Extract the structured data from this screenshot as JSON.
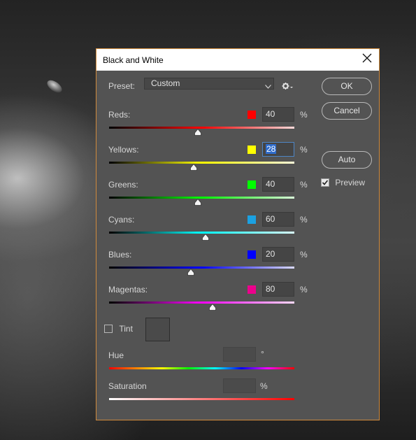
{
  "dialog": {
    "title": "Black and White",
    "close_icon": "close-icon"
  },
  "preset": {
    "label": "Preset:",
    "value": "Custom",
    "gear_icon": "gear-icon"
  },
  "buttons": {
    "ok": "OK",
    "cancel": "Cancel",
    "auto": "Auto"
  },
  "preview": {
    "label": "Preview",
    "checked": true
  },
  "channels": [
    {
      "label": "Reds:",
      "value": "40",
      "unit": "%",
      "color": "#ff0000",
      "track_gradient": [
        "#000000",
        "#ff0000",
        "#ffd9d9"
      ]
    },
    {
      "label": "Yellows:",
      "value": "28",
      "unit": "%",
      "color": "#ffff00",
      "track_gradient": [
        "#000000",
        "#ffff00",
        "#ffffd9"
      ]
    },
    {
      "label": "Greens:",
      "value": "40",
      "unit": "%",
      "color": "#00ff00",
      "track_gradient": [
        "#000000",
        "#00ff00",
        "#d9ffd9"
      ]
    },
    {
      "label": "Cyans:",
      "value": "60",
      "unit": "%",
      "color": "#1ba1e2",
      "track_gradient": [
        "#000000",
        "#00ffff",
        "#d9ffff"
      ]
    },
    {
      "label": "Blues:",
      "value": "20",
      "unit": "%",
      "color": "#0000ff",
      "track_gradient": [
        "#000000",
        "#0000ff",
        "#d9d9ff"
      ]
    },
    {
      "label": "Magentas:",
      "value": "80",
      "unit": "%",
      "color": "#ec008c",
      "track_gradient": [
        "#000000",
        "#ff00ff",
        "#ffd9ff"
      ]
    }
  ],
  "slider_range": [
    -200,
    300
  ],
  "tint": {
    "label": "Tint",
    "checked": false
  },
  "hue": {
    "label": "Hue",
    "value": "",
    "unit": "°"
  },
  "saturation": {
    "label": "Saturation",
    "value": "",
    "unit": "%"
  }
}
